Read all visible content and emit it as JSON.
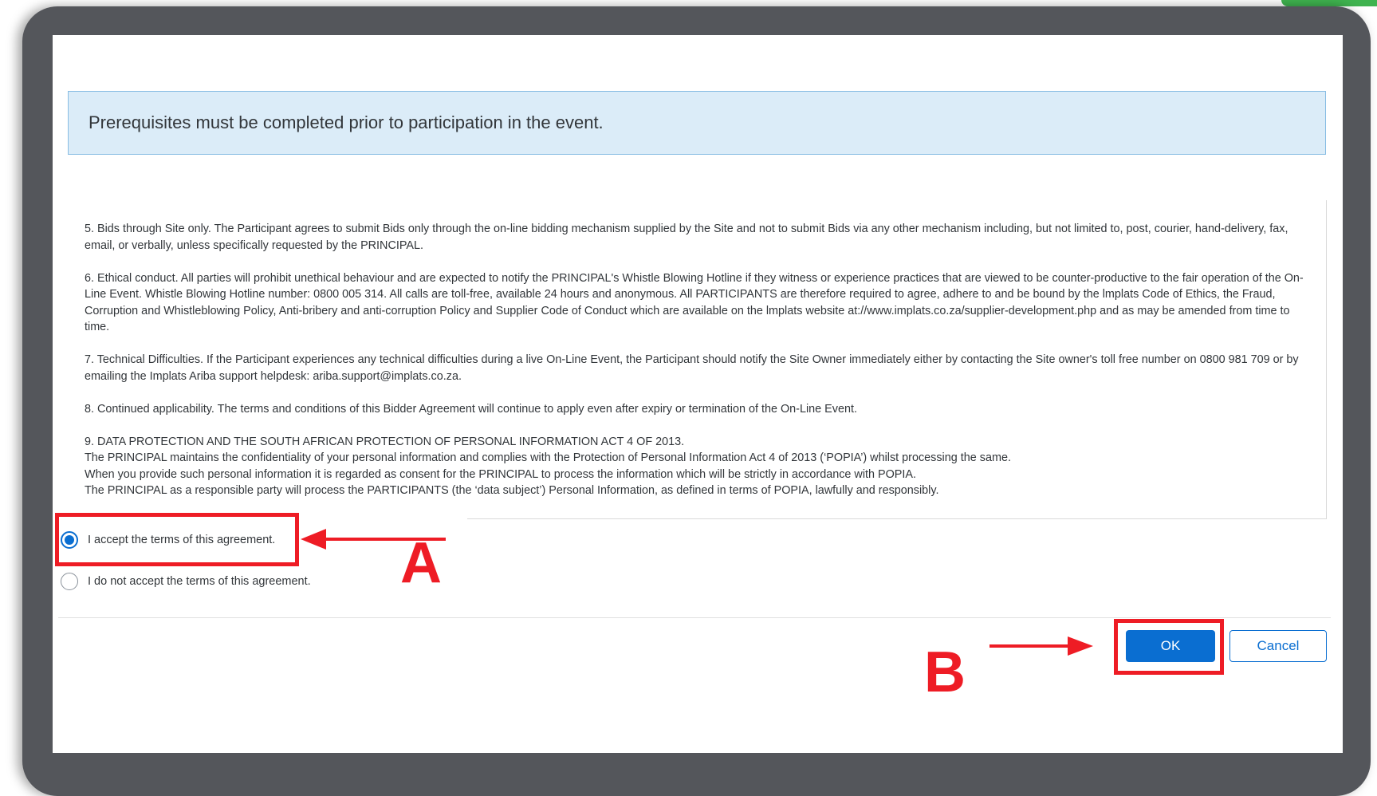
{
  "notice": {
    "text": "Prerequisites must be completed prior to participation in the event."
  },
  "terms": [
    "5. Bids through Site only. The Participant agrees to submit Bids only through the on-line bidding mechanism supplied by the Site and not to submit Bids via any other mechanism including, but not limited to, post, courier, hand-delivery, fax, email, or verbally, unless specifically requested by the PRINCIPAL.",
    "6. Ethical conduct. All parties will prohibit unethical behaviour and are expected to notify the PRINCIPAL's Whistle Blowing Hotline if they witness or experience practices that are viewed to be counter-productive to the fair operation of the On-Line Event. Whistle Blowing Hotline number: 0800 005 314. All calls are toll-free, available 24 hours and anonymous. All PARTICIPANTS are therefore required to agree, adhere to and be bound by the lmplats Code of Ethics, the Fraud, Corruption and Whistleblowing Policy, Anti-bribery and anti-corruption Policy and Supplier Code of Conduct which are available on the lmplats website at://www.implats.co.za/supplier-development.php and as may be amended from time to time.",
    "7. Technical Difficulties. If the Participant experiences any technical difficulties during a live On-Line Event, the Participant should notify the Site Owner immediately either by contacting the Site owner's toll free number on 0800 981 709 or by emailing the Implats Ariba support helpdesk: ariba.support@implats.co.za.",
    "8. Continued applicability. The terms and conditions of this Bidder Agreement will continue to apply even after expiry or termination of the On-Line Event."
  ],
  "popia": {
    "heading": "9. DATA PROTECTION AND THE SOUTH AFRICAN PROTECTION OF PERSONAL INFORMATION ACT 4 OF 2013.",
    "line1": "The PRINCIPAL maintains the confidentiality of your personal information and complies with the Protection of Personal Information Act 4 of 2013 (‘POPIA’) whilst processing the same.",
    "line2": "When you provide such personal information it is regarded as consent for the PRINCIPAL to process the information which will be strictly in accordance with POPIA.",
    "line3": "The PRINCIPAL as a responsible party will process the PARTICIPANTS (the ‘data subject’) Personal Information, as defined in terms of POPIA, lawfully and responsibly."
  },
  "options": {
    "accept_label": "I accept the terms of this agreement.",
    "decline_label": "I do not accept the terms of this agreement.",
    "selected": "accept"
  },
  "buttons": {
    "ok_label": "OK",
    "cancel_label": "Cancel"
  },
  "annotations": {
    "a_label": "A",
    "b_label": "B"
  },
  "colors": {
    "primary": "#0a6ed1",
    "annotation": "#ee1c25",
    "notice_bg": "#dbecf8",
    "frame": "#54565b"
  }
}
